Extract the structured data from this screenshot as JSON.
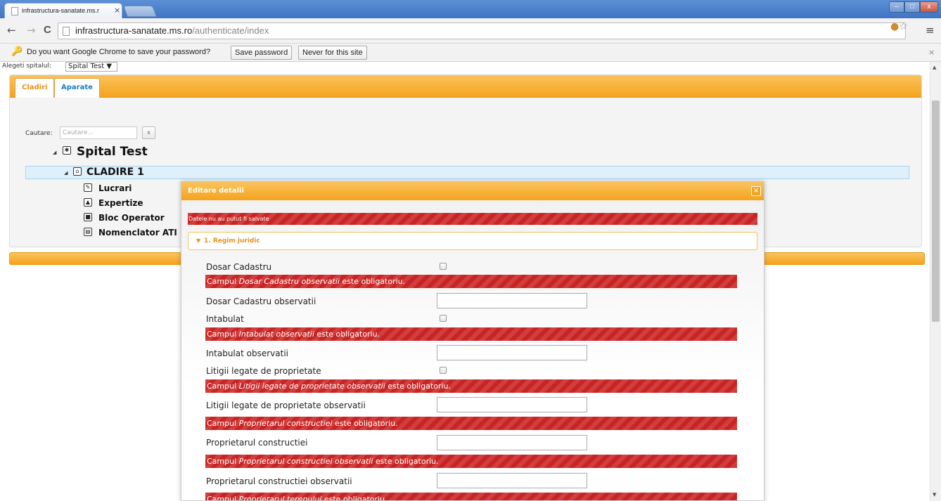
{
  "browser": {
    "tab_title": "infrastructura-sanatate.ms.r",
    "tab_close": "×",
    "window_min": "–",
    "window_max": "□",
    "window_close": "x",
    "nav_back": "←",
    "nav_forward": "→",
    "nav_reload": "C",
    "url_host": "infrastructura-sanatate.ms.ro",
    "url_path": "/authenticate/index",
    "menu_icon": "≡"
  },
  "infobar": {
    "message": "Do you want Google Chrome to save your password?",
    "save_label": "Save password",
    "never_label": "Never for this site",
    "close": "×"
  },
  "page": {
    "hospital_label": "Alegeti spitalul:",
    "hospital_selected": "Spital Test ▼",
    "tabs": [
      {
        "label": "Cladiri"
      },
      {
        "label": "Aparate"
      }
    ],
    "search": {
      "label": "Cautare:",
      "placeholder": "Cautare...",
      "clear": "x"
    },
    "tree": {
      "root": "Spital Test",
      "building": "CLADIRE 1",
      "children": [
        "Lucrari",
        "Expertize",
        "Bloc Operator",
        "Nomenclator ATI"
      ]
    }
  },
  "dialog": {
    "title": "Editare detalii",
    "close": "×",
    "save_error": "Datele nu au putut fi salvate",
    "section_title": "1. Regim juridic",
    "fields": [
      {
        "label": "Dosar Cadastru"
      },
      {
        "error_prefix": "Campul ",
        "error_field": "Dosar Cadastru observatii",
        "error_suffix": " este obligatoriu."
      },
      {
        "label": "Dosar Cadastru observatii"
      },
      {
        "label": "Intabulat"
      },
      {
        "error_prefix": "Campul ",
        "error_field": "Intabulat observatii",
        "error_suffix": " este obligatoriu."
      },
      {
        "label": "Intabulat observatii"
      },
      {
        "label": "Litigii legate de proprietate"
      },
      {
        "error_prefix": "Campul ",
        "error_field": "Litigii legate de proprietate observatii",
        "error_suffix": " este obligatoriu."
      },
      {
        "label": "Litigii legate de proprietate observatii"
      },
      {
        "error_prefix": "Campul ",
        "error_field": "Proprietarul constructiei",
        "error_suffix": " este obligatoriu."
      },
      {
        "label": "Proprietarul constructiei"
      },
      {
        "error_prefix": "Campul ",
        "error_field": "Proprietarul constructiei observatii",
        "error_suffix": " este obligatoriu."
      },
      {
        "label": "Proprietarul constructiei observatii"
      },
      {
        "error_prefix": "Campul ",
        "error_field": "Proprietarul terenului",
        "error_suffix": " este obligatoriu."
      }
    ]
  },
  "colors": {
    "accent_orange": "#f4a31f",
    "error_red": "#c92424",
    "link_blue": "#1a7cc1"
  }
}
